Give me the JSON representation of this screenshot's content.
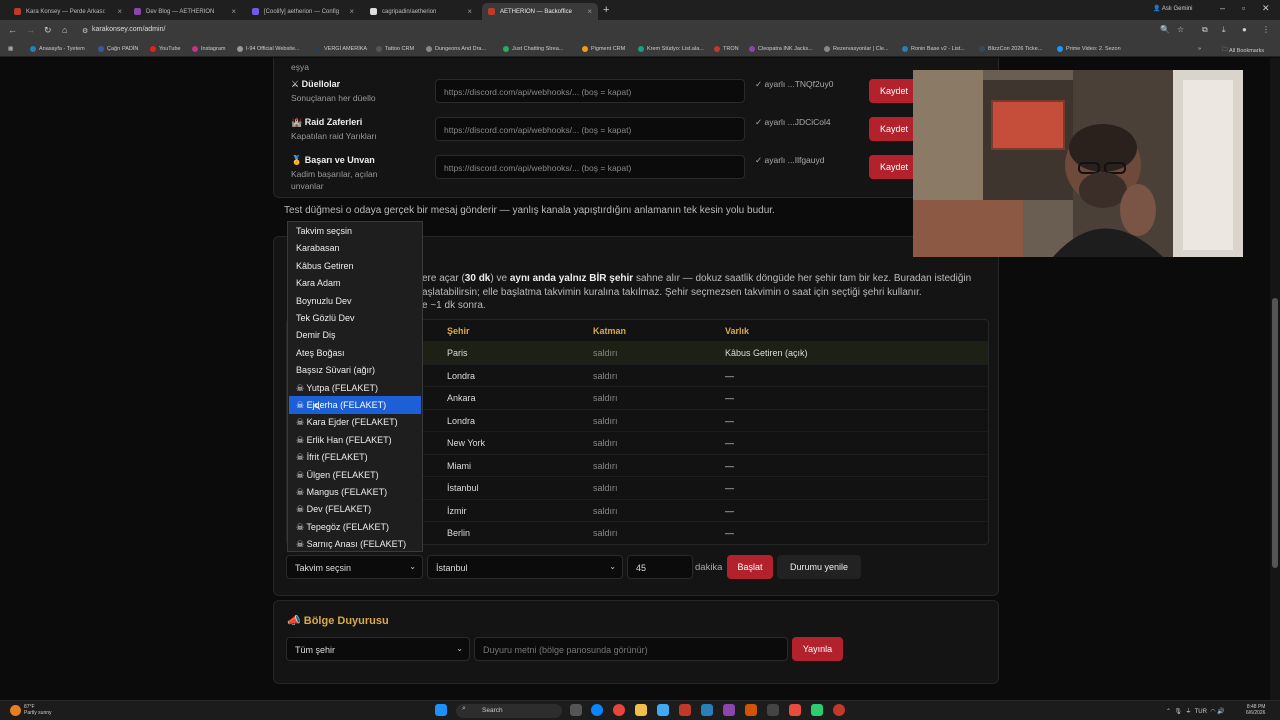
{
  "browser": {
    "tabs": [
      {
        "title": "Kara Konsey — Perde Arkası: ",
        "color": "#c0392b"
      },
      {
        "title": "Dev Blog — AETHERION",
        "color": "#8e44ad"
      },
      {
        "title": "[Coolify] aetherion — Config",
        "color": "#6c5ce7"
      },
      {
        "title": "cagripadin/aetherion",
        "color": "#dddddd"
      },
      {
        "title": "AETHERION — Backoffice",
        "color": "#c0392b"
      }
    ],
    "profile_name": "Aslı Gemini",
    "url": "karakonsey.com/admin/",
    "bookmarks": [
      {
        "label": "Anasayfa - Tyetem",
        "color": "#2980b9"
      },
      {
        "label": "Çağrı PADİN",
        "color": "#3b5998"
      },
      {
        "label": "YouTube",
        "color": "#e62117"
      },
      {
        "label": "Instagram",
        "color": "#c13584"
      },
      {
        "label": "I-94 Official Website...",
        "color": "#999999"
      },
      {
        "label": "VERGİ AMERİKA",
        "color": "#2c3e50"
      },
      {
        "label": "Tattoo CRM",
        "color": "#555555"
      },
      {
        "label": "Dungeons And Dra...",
        "color": "#888888"
      },
      {
        "label": "Just Chatting Strea...",
        "color": "#27ae60"
      },
      {
        "label": "Pigment CRM",
        "color": "#f39c12"
      },
      {
        "label": "Krem Stüdyo: List.ala...",
        "color": "#16a085"
      },
      {
        "label": "TRON",
        "color": "#c0392b"
      },
      {
        "label": "Cleopatra INK Jacks...",
        "color": "#8e44ad"
      },
      {
        "label": "Rezervasyonlar | Cle...",
        "color": "#888888"
      },
      {
        "label": "Ronin Base v2 - List...",
        "color": "#2980b9"
      },
      {
        "label": "BlizzCon 2026 Ticke...",
        "color": "#34495e"
      },
      {
        "label": "Prime Video: 2. Sezon",
        "color": "#1a98ff"
      }
    ],
    "all_bookmarks": "All Bookmarks"
  },
  "webhooks": {
    "top_fragment": "eşya",
    "rows": [
      {
        "icon": "⚔",
        "title": "Düellolar",
        "subtitle": "Sonuçlanan her düello",
        "placeholder": "https://discord.com/api/webhooks/... (boş = kapat)",
        "status": "✓ ayarlı ...TNQf2uy0",
        "button": "Kaydet"
      },
      {
        "icon": "🏰",
        "title": "Raid Zaferleri",
        "subtitle": "Kapatılan raid Yarıkları",
        "placeholder": "https://discord.com/api/webhooks/... (boş = kapat)",
        "status": "✓ ayarlı ...JDCiCol4",
        "button": "Kaydet"
      },
      {
        "icon": "🏅",
        "title": "Başarı ve Unvan",
        "subtitle": "Kadim başarılar, açılan unvanlar",
        "placeholder": "https://discord.com/api/webhooks/... (boş = kapat)",
        "status": "✓ ayarlı ...Ilfgauyd",
        "button": "Kaydet"
      }
    ],
    "test_note": "Test düğmesi o odaya gerçek bir mesaj gönderir — yanlış kanala yapıştırdığını anlamanın tek kesin yolu budur."
  },
  "schedule": {
    "desc_line1_a": "ere açar (",
    "desc_line1_b": "30 dk",
    "desc_line1_c": ") ve ",
    "desc_line1_d": "aynı anda yalnız BİR şehir",
    "desc_line1_e": " sahne alır — dokuz saatlik döngüde her şehir tam bir kez. Buradan istediğin",
    "desc_line2": "aşlatabilirsin; elle başlatma takvimin kuralına takılmaz. Şehir seçmezsen takvimin o saat için seçtiği şehri kullanır.",
    "desc_line3": "e ~1 dk sonra.",
    "columns": {
      "city": "Şehir",
      "layer": "Katman",
      "entity": "Varlık"
    },
    "rows": [
      {
        "city": "Paris",
        "layer": "saldırı",
        "entity": "Kâbus Getiren (açık)"
      },
      {
        "city": "Londra",
        "layer": "saldırı",
        "entity": "—"
      },
      {
        "city": "Ankara",
        "layer": "saldırı",
        "entity": "—"
      },
      {
        "city": "Londra",
        "layer": "saldırı",
        "entity": "—"
      },
      {
        "city": "New York",
        "layer": "saldırı",
        "entity": "—"
      },
      {
        "city": "Miami",
        "layer": "saldırı",
        "entity": "—"
      },
      {
        "city": "İstanbul",
        "layer": "saldırı",
        "entity": "—"
      },
      {
        "city": "İzmir",
        "layer": "saldırı",
        "entity": "—"
      },
      {
        "city": "Berlin",
        "layer": "saldırı",
        "entity": "—"
      }
    ],
    "controls": {
      "schedule_select": "Takvim seçsin",
      "city_select": "İstanbul",
      "minutes_value": "45",
      "minutes_label": "dakika",
      "start_button": "Başlat",
      "refresh_button": "Durumu yenile"
    },
    "dropdown_options": [
      "Takvim seçsin",
      "Karabasan",
      "Kâbus Getiren",
      "Kara Adam",
      "Boynuzlu Dev",
      "Tek Gözlü Dev",
      "Demir Diş",
      "Ateş Boğası",
      "Başsız Süvari (ağır)",
      "☠ Yutpa (FELAKET)",
      "☠ Ejderha (FELAKET)",
      "☠ Kara Ejder (FELAKET)",
      "☠ Erlik Han (FELAKET)",
      "☠ İfrit (FELAKET)",
      "☠ Ülgen (FELAKET)",
      "☠ Mangus (FELAKET)",
      "☠ Dev (FELAKET)",
      "☠ Tepegöz (FELAKET)",
      "☠ Sarnıç Anası (FELAKET)"
    ],
    "dropdown_highlighted": 10
  },
  "announcement": {
    "icon": "📣",
    "title": "Bölge Duyurusu",
    "scope_select": "Tüm şehir",
    "text_placeholder": "Duyuru metni (bölge panosunda görünür)",
    "publish_button": "Yayınla"
  },
  "taskbar": {
    "weather_temp": "87°F",
    "weather_desc": "Partly sunny",
    "search_label": "Search",
    "lang": "TUR",
    "time": "8:48 PM",
    "date": "6/6/2026"
  },
  "colors": {
    "accent_red": "#b3222c",
    "gold_heading": "#d9a94a",
    "selected_option": "#1d5fd6"
  }
}
